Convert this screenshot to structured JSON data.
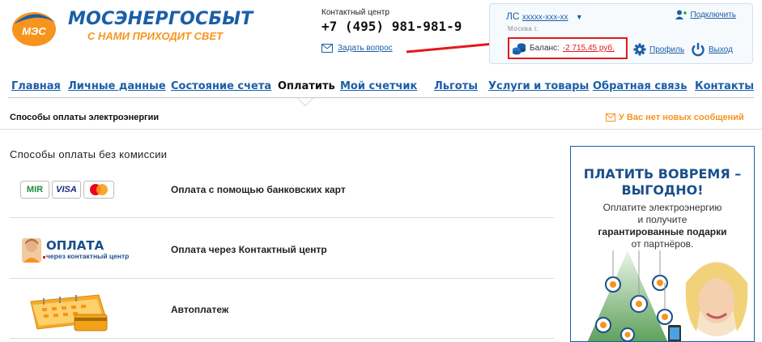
{
  "brand": {
    "logo_text": "МЭС",
    "name": "МОСЭНЕРГОСБЫТ",
    "slogan": "С НАМИ ПРИХОДИТ СВЕТ"
  },
  "contact": {
    "label": "Контактный центр",
    "phone": "+7 (495) 981-981-9",
    "ask_link": "Задать вопрос"
  },
  "account": {
    "prefix": "ЛС",
    "number": "xxxxx-xxx-xx",
    "city": "Москва г.",
    "connect_link": "Подключить",
    "balance_label": "Баланс:",
    "balance_value": "-2 715,45 руб.",
    "profile_link": "Профиль",
    "logout_link": "Выход"
  },
  "nav": {
    "items": [
      {
        "label": "Главная"
      },
      {
        "label": "Личные данные"
      },
      {
        "label": "Состояние счета"
      },
      {
        "label": "Оплатить"
      },
      {
        "label": "Мой счетчик"
      },
      {
        "label": "Льготы"
      },
      {
        "label": "Услуги и товары"
      },
      {
        "label": "Обратная связь"
      },
      {
        "label": "Контакты"
      }
    ],
    "active_index": 3
  },
  "page": {
    "subtitle": "Способы оплаты электроэнергии",
    "messages": "У Вас нет новых сообщений",
    "section_title": "Способы оплаты без комиссии"
  },
  "methods": [
    {
      "label": "Оплата с помощью банковских карт"
    },
    {
      "label": "Оплата через Контактный центр",
      "logo_title": "ОПЛАТА",
      "logo_sub": "через контактный центр"
    },
    {
      "label": "Автоплатеж"
    }
  ],
  "card_logos": [
    "MIR",
    "VISA"
  ],
  "banner": {
    "title_line1": "ПЛАТИТЬ ВОВРЕМЯ –",
    "title_line2": "ВЫГОДНО!",
    "text_line1": "Оплатите электроэнергию",
    "text_line2": "и получите",
    "text_line3": "гарантированные подарки",
    "text_line4": "от партнёров."
  },
  "colors": {
    "brand_blue": "#1b5ea8",
    "brand_orange": "#f7941d",
    "alert_red": "#e2191c"
  }
}
